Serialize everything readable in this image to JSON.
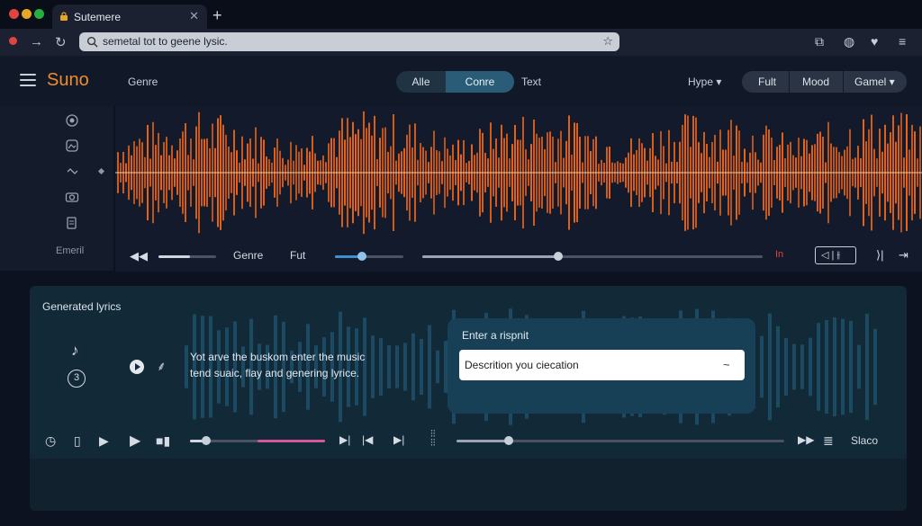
{
  "browser": {
    "tab_title": "Sutemere",
    "new_tab": "+",
    "tab_close": "✕",
    "url_text": "semetal tot to geene lysic.",
    "traffic_lights": [
      "#e0443e",
      "#e6a623",
      "#27b03f"
    ]
  },
  "header": {
    "logo": "Suno",
    "genre_label": "Genre",
    "segmented": [
      "Alle",
      "Conre"
    ],
    "text_label": "Text",
    "hype_label": "Hype ▾",
    "pills": [
      "Fult",
      "Mood",
      "Gamel ▾"
    ]
  },
  "sidebar": {
    "label": "Emeril"
  },
  "transport_top": {
    "genre_label": "Genre",
    "fut_label": "Fut",
    "in_label": "In",
    "volume_level": 0.55,
    "slider_level": 0.4,
    "seek_level": 0.4
  },
  "lyrics": {
    "title": "Generated lyrics",
    "line1": "Yot arve the buskom enter the music",
    "line2": "tend suaic, flay and genering lyrice.",
    "badge": "3",
    "prompt_label": "Enter a rispnit",
    "prompt_value": "Descrition you ciecation",
    "prompt_chevron": "~"
  },
  "transport_bottom": {
    "slaco_label": "Slaco",
    "progress_level": 0.12,
    "pink_start": 0.5,
    "seek_level": 0.16
  },
  "colors": {
    "accent_orange": "#f08c2e",
    "waveform_orange": "#e8641a",
    "teal_wave": "#1c4a63",
    "pink": "#d6579d",
    "blue_slider": "#3f8fcf"
  }
}
